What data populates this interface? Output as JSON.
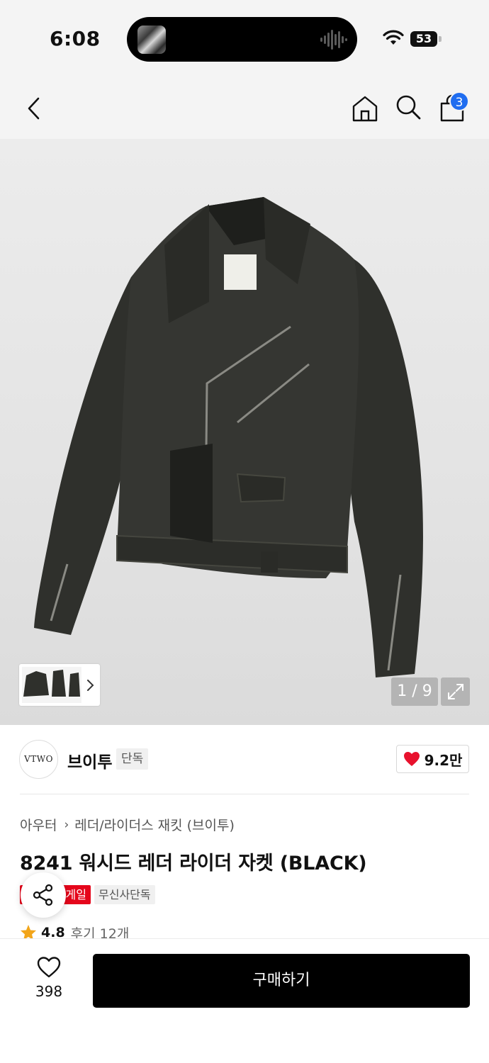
{
  "status_bar": {
    "time": "6:08",
    "battery": "53"
  },
  "header": {
    "cart_count": "3"
  },
  "gallery": {
    "pager": "1 / 9"
  },
  "brand": {
    "logo_text": "VTWO",
    "name": "브이투",
    "tag": "단독",
    "like_count": "9.2만"
  },
  "product": {
    "breadcrumb": [
      "아우터",
      "레더/라이더스 재킷 (브이투)"
    ],
    "title": "8241 워시드 레더 라이더 자켓 (BLACK)",
    "sale_tag": "세일",
    "sale_tag_visible": "게일",
    "exclusive_tag": "무신사단독",
    "rating": "4.8",
    "reviews": "후기 12개"
  },
  "bottom": {
    "wish_count": "398",
    "buy_label": "구매하기"
  },
  "colors": {
    "accent_blue": "#1f6df0",
    "sale_red": "#e5061b",
    "heart_red": "#e8112d",
    "star": "#f2a51a"
  }
}
